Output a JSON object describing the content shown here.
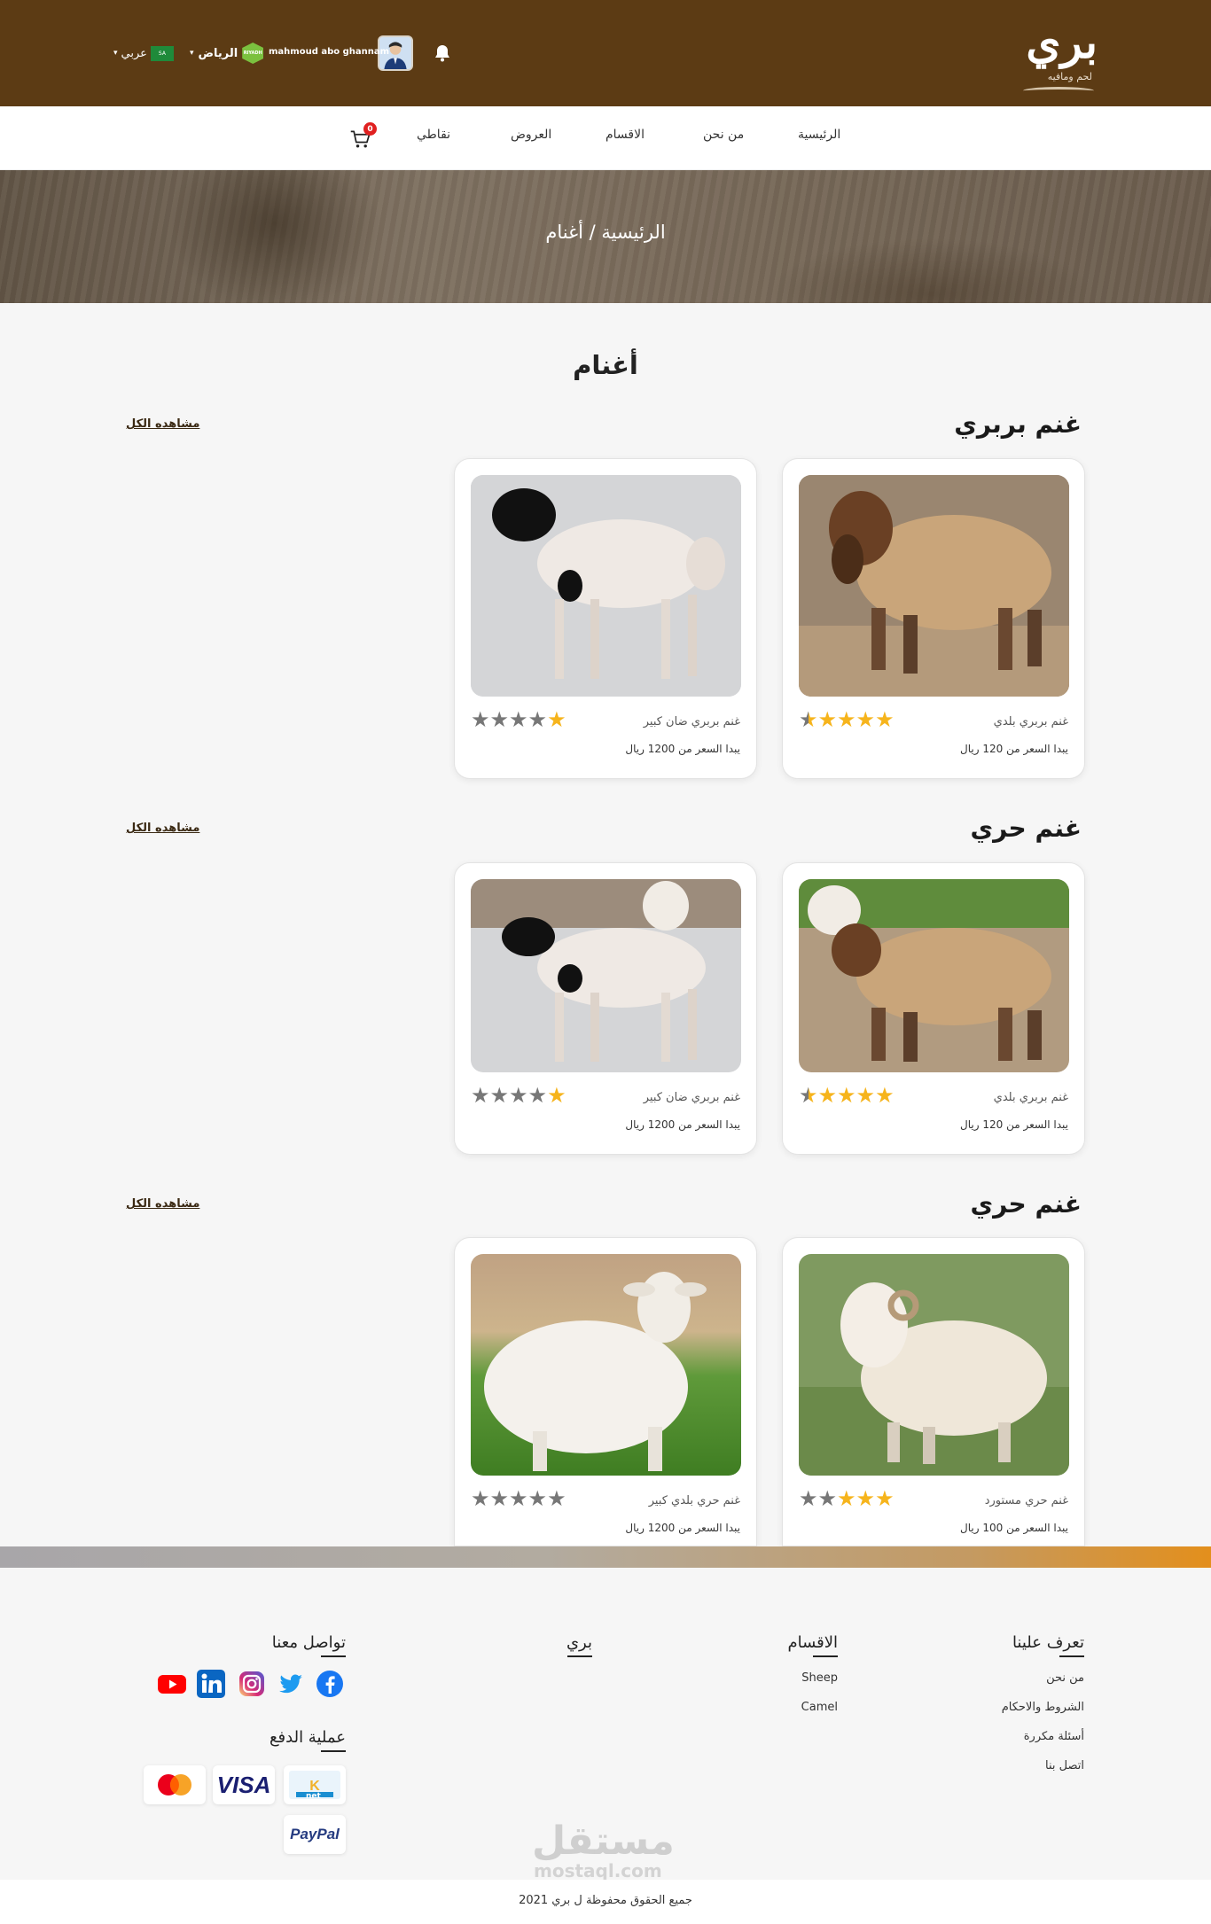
{
  "header": {
    "logo_text": "بري",
    "logo_tagline": "لحم ومافيه",
    "username": "mahmoud abo ghannam",
    "city_badge": "RIYADH",
    "city": "الرياض",
    "flag_text": "SA",
    "language": "عربي"
  },
  "nav": {
    "items": [
      "الرئيسية",
      "من نحن",
      "الاقسام",
      "العروض",
      "نقاطي"
    ],
    "cart_count": "0"
  },
  "hero": {
    "breadcrumb": "الرئيسية / أغنام"
  },
  "page_title": "أغنام",
  "sections": [
    {
      "title": "غنم بربري",
      "view_all": "مشاهده الكل",
      "products": [
        {
          "name": "غنم بربري بلدي",
          "price": "يبدا السعر من 120 ريال",
          "rating": 4.5
        },
        {
          "name": "غنم بربري ضان كبير",
          "price": "يبدا السعر من 1200 ريال",
          "rating": 1
        }
      ]
    },
    {
      "title": "غنم حري",
      "view_all": "مشاهده الكل",
      "products": [
        {
          "name": "غنم بربري بلدي",
          "price": "يبدا السعر من 120 ريال",
          "rating": 4.5
        },
        {
          "name": "غنم بربري ضان كبير",
          "price": "يبدا السعر من 1200 ريال",
          "rating": 1
        }
      ]
    },
    {
      "title": "غنم حري",
      "view_all": "مشاهده الكل",
      "products": [
        {
          "name": "غنم حري مستورد",
          "price": "يبدا السعر من 100 ريال",
          "rating": 3
        },
        {
          "name": "غنم حري بلدي كبير",
          "price": "يبدا السعر من 1200 ريال",
          "rating": 0
        }
      ]
    }
  ],
  "footer": {
    "about_heading": "تعرف علينا",
    "about_links": [
      "من نحن",
      "الشروط والاحكام",
      "أسئلة مكررة",
      "اتصل بنا"
    ],
    "categories_heading": "الاقسام",
    "category_links": [
      "Sheep",
      "Camel"
    ],
    "brand_heading": "بري",
    "contact_heading": "تواصل معنا",
    "social": [
      "facebook-icon",
      "twitter-icon",
      "instagram-icon",
      "linkedin-icon",
      "youtube-icon"
    ],
    "payment_heading": "عملية الدفع",
    "payment_methods": [
      "knet",
      "VISA",
      "mastercard",
      "PayPal"
    ],
    "knet_text": "net",
    "visa_text": "VISA",
    "paypal_text": "PayPal",
    "watermark": "مستقل",
    "watermark_sub": "mostaql.com",
    "copyright": "جميع الحقوق محفوظة ل بري 2021"
  },
  "colors": {
    "brand_brown": "#5c3b14",
    "star_on": "#f6b41c",
    "star_off": "#777777",
    "cart_badge": "#e02020",
    "footer_accent": "#e38f1c"
  }
}
